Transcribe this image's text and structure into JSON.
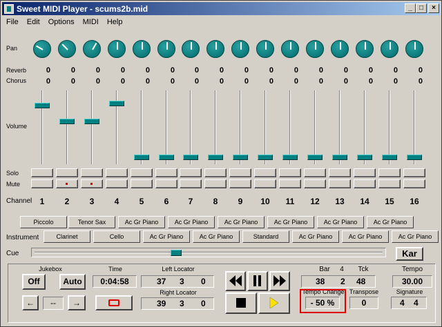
{
  "window": {
    "title": "Sweet MIDI Player - scums2b.mid",
    "min": "_",
    "max": "□",
    "close": "×"
  },
  "menu": [
    "File",
    "Edit",
    "Options",
    "MIDI",
    "Help"
  ],
  "labels": {
    "pan": "Pan",
    "reverb": "Reverb",
    "chorus": "Chorus",
    "volume": "Volume",
    "solo": "Solo",
    "mute": "Mute",
    "channel": "Channel",
    "instrument": "Instrument",
    "cue": "Cue"
  },
  "channels": [
    {
      "num": "1",
      "reverb": "0",
      "chorus": "0",
      "volume": 0.79,
      "muted": false
    },
    {
      "num": "2",
      "reverb": "0",
      "chorus": "0",
      "volume": 0.55,
      "muted": true
    },
    {
      "num": "3",
      "reverb": "0",
      "chorus": "0",
      "volume": 0.55,
      "muted": true
    },
    {
      "num": "4",
      "reverb": "0",
      "chorus": "0",
      "volume": 0.82,
      "muted": false
    },
    {
      "num": "5",
      "reverb": "0",
      "chorus": "0",
      "volume": 0.0,
      "muted": false
    },
    {
      "num": "6",
      "reverb": "0",
      "chorus": "0",
      "volume": 0.0,
      "muted": false
    },
    {
      "num": "7",
      "reverb": "0",
      "chorus": "0",
      "volume": 0.0,
      "muted": false
    },
    {
      "num": "8",
      "reverb": "0",
      "chorus": "0",
      "volume": 0.0,
      "muted": false
    },
    {
      "num": "9",
      "reverb": "0",
      "chorus": "0",
      "volume": 0.0,
      "muted": false
    },
    {
      "num": "10",
      "reverb": "0",
      "chorus": "0",
      "volume": 0.0,
      "muted": false
    },
    {
      "num": "11",
      "reverb": "0",
      "chorus": "0",
      "volume": 0.0,
      "muted": false
    },
    {
      "num": "12",
      "reverb": "0",
      "chorus": "0",
      "volume": 0.0,
      "muted": false
    },
    {
      "num": "13",
      "reverb": "0",
      "chorus": "0",
      "volume": 0.0,
      "muted": false
    },
    {
      "num": "14",
      "reverb": "0",
      "chorus": "0",
      "volume": 0.0,
      "muted": false
    },
    {
      "num": "15",
      "reverb": "0",
      "chorus": "0",
      "volume": 0.0,
      "muted": false
    },
    {
      "num": "16",
      "reverb": "0",
      "chorus": "0",
      "volume": 0.0,
      "muted": false
    }
  ],
  "pan_angles_deg": [
    -60,
    -45,
    30,
    0,
    0,
    0,
    0,
    0,
    0,
    0,
    0,
    0,
    0,
    0,
    0,
    0
  ],
  "instruments_top": [
    "Piccolo",
    "Tenor Sax",
    "Ac Gr Piano",
    "Ac Gr Piano",
    "Ac Gr Piano",
    "Ac Gr Piano",
    "Ac Gr Piano",
    "Ac Gr Piano"
  ],
  "instruments_bottom": [
    "Clarinet",
    "Cello",
    "Ac Gr Piano",
    "Ac Gr Piano",
    "Standard",
    "Ac Gr Piano",
    "Ac Gr Piano",
    "Ac Gr Piano"
  ],
  "kar": "Kar",
  "jukebox": {
    "label": "Jukebox",
    "off": "Off",
    "auto": "Auto",
    "prev": "←",
    "next": "→",
    "track": "--"
  },
  "time": {
    "label": "Time",
    "value": "0:04:58"
  },
  "left_locator": {
    "label": "Left Locator",
    "bar": "37",
    "beat": "3",
    "tick": "0"
  },
  "right_locator": {
    "label": "Right Locator",
    "bar": "39",
    "beat": "3",
    "tick": "0"
  },
  "position": {
    "bar_label": "Bar",
    "beats": "4",
    "tck_label": "Tck",
    "bar": "38",
    "beat": "2",
    "tick": "48"
  },
  "tempo": {
    "label": "Tempo",
    "value": "30.00"
  },
  "tempo_change": {
    "label": "Tempo Change",
    "value": "- 50 %"
  },
  "transpose": {
    "label": "Transpose",
    "value": "0"
  },
  "signature": {
    "label": "Signature",
    "num": "4",
    "den": "4"
  }
}
